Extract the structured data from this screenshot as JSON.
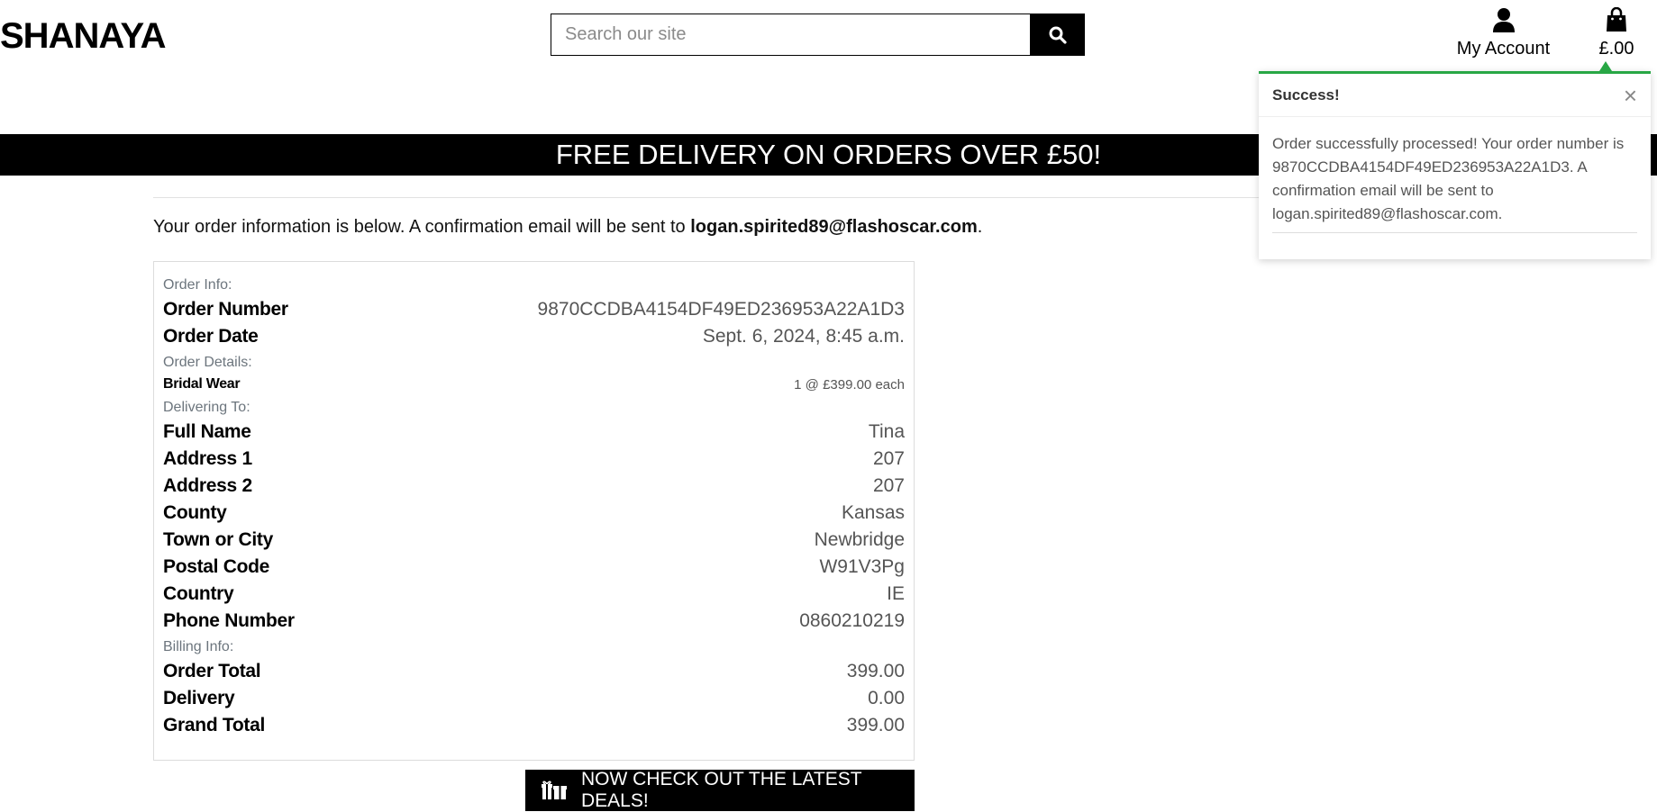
{
  "header": {
    "brand": "SHANAYA",
    "search_placeholder": "Search our site",
    "account_label": "My Account",
    "bag_total": "£.00"
  },
  "banner": {
    "text": "FREE DELIVERY ON ORDERS OVER £50!"
  },
  "intro": {
    "text": "Your order information is below. A confirmation email will be sent to ",
    "email": "logan.spirited89@flashoscar.com",
    "end": "."
  },
  "order": {
    "order_info_label": "Order Info:",
    "order_number_label": "Order Number",
    "order_number": "9870CCDBA4154DF49ED236953A22A1D3",
    "order_date_label": "Order Date",
    "order_date": "Sept. 6, 2024, 8:45 a.m.",
    "order_details_label": "Order Details:",
    "item_name": "Bridal Wear",
    "item_qty_price": "1 @ £399.00 each",
    "delivering_label": "Delivering To:",
    "delivery": [
      {
        "label": "Full Name",
        "value": "Tina"
      },
      {
        "label": "Address 1",
        "value": "207"
      },
      {
        "label": "Address 2",
        "value": "207"
      },
      {
        "label": "County",
        "value": "Kansas"
      },
      {
        "label": "Town or City",
        "value": "Newbridge"
      },
      {
        "label": "Postal Code",
        "value": "W91V3Pg"
      },
      {
        "label": "Country",
        "value": "IE"
      },
      {
        "label": "Phone Number",
        "value": "0860210219"
      }
    ],
    "billing_label": "Billing Info:",
    "billing": [
      {
        "label": "Order Total",
        "value": "399.00"
      },
      {
        "label": "Delivery",
        "value": "0.00"
      },
      {
        "label": "Grand Total",
        "value": "399.00"
      }
    ]
  },
  "deals_button": {
    "label": "NOW CHECK OUT THE LATEST DEALS!",
    "icon": "gift-icon"
  },
  "toast": {
    "title": "Success!",
    "close": "×",
    "message": "Order successfully processed! Your order number is 9870CCDBA4154DF49ED236953A22A1D3. A confirmation email will be sent to logan.spirited89@flashoscar.com.",
    "accent_color": "#28a745"
  },
  "icons": {
    "search": "search-icon",
    "account": "user-icon",
    "bag": "shopping-bag-icon"
  }
}
